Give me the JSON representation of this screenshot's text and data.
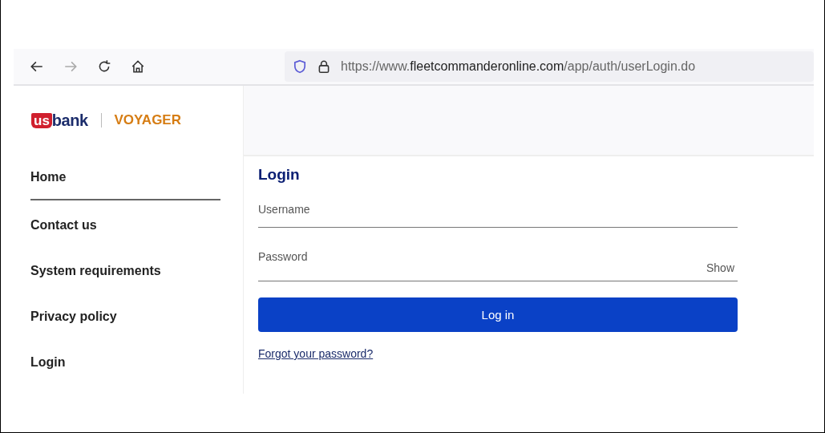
{
  "browser": {
    "url": {
      "scheme": "https://www.",
      "domain": "fleetcommanderonline.com",
      "path": "/app/auth/userLogin.do"
    }
  },
  "logo": {
    "mark": "us",
    "bank": "bank",
    "product": "VOYAGER"
  },
  "sidebar": {
    "items": [
      {
        "label": "Home",
        "selected": true
      },
      {
        "label": "Contact us",
        "selected": false
      },
      {
        "label": "System requirements",
        "selected": false
      },
      {
        "label": "Privacy policy",
        "selected": false
      },
      {
        "label": "Login",
        "selected": false
      }
    ]
  },
  "login": {
    "title": "Login",
    "username": {
      "placeholder": "Username"
    },
    "password": {
      "placeholder": "Password",
      "toggle": "Show"
    },
    "submit": "Log in",
    "forgot": "Forgot your password?"
  }
}
